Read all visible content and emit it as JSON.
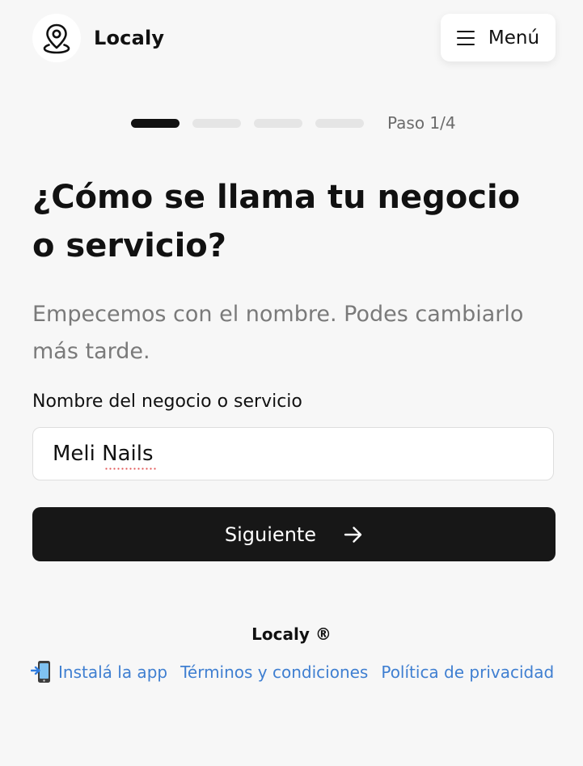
{
  "header": {
    "brand": "Localy",
    "menu_label": "Menú"
  },
  "progress": {
    "step_label": "Paso 1/4",
    "current_step": 1,
    "total_steps": 4
  },
  "form": {
    "title": "¿Cómo se llama tu negocio o servicio?",
    "subtitle": "Empecemos con el nombre. Podes cambiarlo más tarde.",
    "field_label": "Nombre del negocio o servicio",
    "field_value": "Meli Nails",
    "submit_label": "Siguiente"
  },
  "footer": {
    "brand": "Localy ®",
    "links": [
      {
        "label": "Instalá la app"
      },
      {
        "label": "Términos y condiciones"
      },
      {
        "label": "Política de privacidad"
      }
    ]
  },
  "colors": {
    "background": "#f7f7f7",
    "primary": "#171717",
    "link": "#3f7fd1"
  }
}
